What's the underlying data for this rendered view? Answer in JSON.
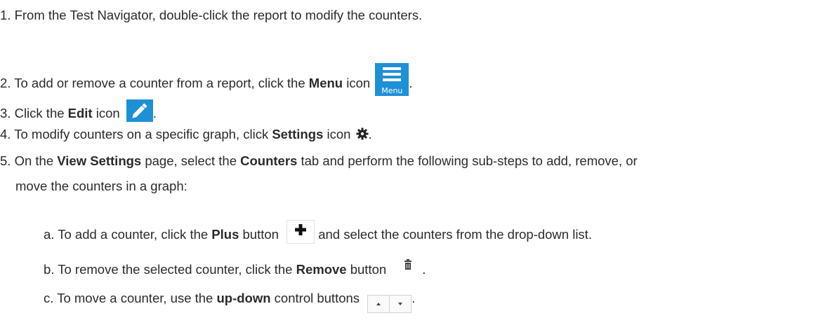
{
  "steps": [
    {
      "num": "1.",
      "text": "From the Test Navigator, double-click the report to modify the counters."
    },
    {
      "num": "2.",
      "pre": "To add or remove a counter from a report, click the ",
      "bold": "Menu",
      "post": " icon",
      "icon_label": "Menu",
      "end": "."
    },
    {
      "num": "3.",
      "pre": "Click the ",
      "bold": "Edit",
      "post": " icon",
      "end": "."
    },
    {
      "num": "4.",
      "pre": "To modify counters on a specific graph, click ",
      "bold": "Settings",
      "post": " icon",
      "end": "."
    },
    {
      "num": "5.",
      "pre": "On the ",
      "bold1": "View Settings",
      "mid": " page, select the ",
      "bold2": "Counters",
      "post": " tab and perform the following sub-steps to add, remove, or",
      "line2": "move the counters in a graph:"
    }
  ],
  "substeps": [
    {
      "letter": "a.",
      "pre": "To add a counter, click the ",
      "bold": "Plus",
      "post": " button",
      "after": " and select the counters from the drop-down list."
    },
    {
      "letter": "b.",
      "pre": "To remove the selected counter, click the ",
      "bold": "Remove",
      "post": " button",
      "end": "."
    },
    {
      "letter": "c.",
      "pre": "To move a counter, use the ",
      "bold": "up-down",
      "post": " control buttons",
      "end": "."
    }
  ],
  "icons": {
    "menu": "menu-icon",
    "edit": "pencil-icon",
    "settings": "gear-icon",
    "plus": "plus-icon",
    "remove": "trash-icon",
    "updown": "up-down-arrows-icon"
  },
  "colors": {
    "icon_bg": "#1e90d6",
    "text": "#2b2b2b"
  }
}
